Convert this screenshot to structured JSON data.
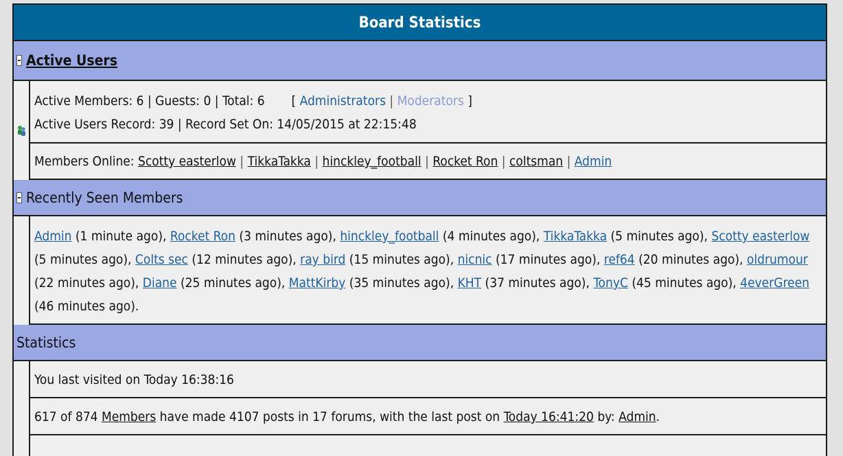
{
  "title": "Board Statistics",
  "active_users": {
    "heading": "Active Users",
    "counts": "Active Members: 6 | Guests: 0 | Total: 6",
    "bracket_open": "[",
    "bracket_close": "]",
    "administrators": "Administrators",
    "moderators": "Moderators",
    "record": "Active Users Record: 39 | Record Set On: 14/05/2015 at 22:15:48",
    "members_online_label": "Members Online:",
    "members_online": [
      "Scotty easterlow",
      "TikkaTakka",
      "hinckley_football",
      "Rocket Ron",
      "coltsman",
      "Admin"
    ],
    "separator": "|"
  },
  "recently_seen": {
    "heading": "Recently Seen Members",
    "members": [
      {
        "name": "Admin",
        "ago": "(1 minute ago),"
      },
      {
        "name": "Rocket Ron",
        "ago": "(3 minutes ago),"
      },
      {
        "name": "hinckley_football",
        "ago": "(4 minutes ago),"
      },
      {
        "name": "TikkaTakka",
        "ago": "(5 minutes ago),"
      },
      {
        "name": "Scotty easterlow",
        "ago": "(5 minutes ago),"
      },
      {
        "name": "Colts sec",
        "ago": "(12 minutes ago),"
      },
      {
        "name": "ray bird",
        "ago": "(15 minutes ago),"
      },
      {
        "name": "nicnic",
        "ago": "(17 minutes ago),"
      },
      {
        "name": "ref64",
        "ago": "(20 minutes ago),"
      },
      {
        "name": "oldrumour",
        "ago": "(22 minutes ago),"
      },
      {
        "name": "Diane",
        "ago": "(25 minutes ago),"
      },
      {
        "name": "MattKirby",
        "ago": "(35 minutes ago),"
      },
      {
        "name": "KHT",
        "ago": "(37 minutes ago),"
      },
      {
        "name": "TonyC",
        "ago": "(45 minutes ago),"
      },
      {
        "name": "4everGreen",
        "ago": "(46 minutes ago)."
      }
    ]
  },
  "statistics": {
    "heading": "Statistics",
    "last_visited": "You last visited on Today 16:38:16",
    "members_pre": "617 of 874",
    "members_link": "Members",
    "members_mid": "have made 4107 posts in 17 forums, with the last post on",
    "last_post_link": "Today 16:41:20",
    "by_text": "by:",
    "by_user": "Admin",
    "end_dot": "."
  },
  "colors": {
    "title_bg": "#006699",
    "category_bg": "#9aa9e3",
    "link": "#1e5f99",
    "faded_link": "#8a9bd1",
    "row_bg": "#efefef"
  },
  "icons": {
    "collapse": "minus-toggle-icon",
    "active_users": "users-group-icon"
  }
}
